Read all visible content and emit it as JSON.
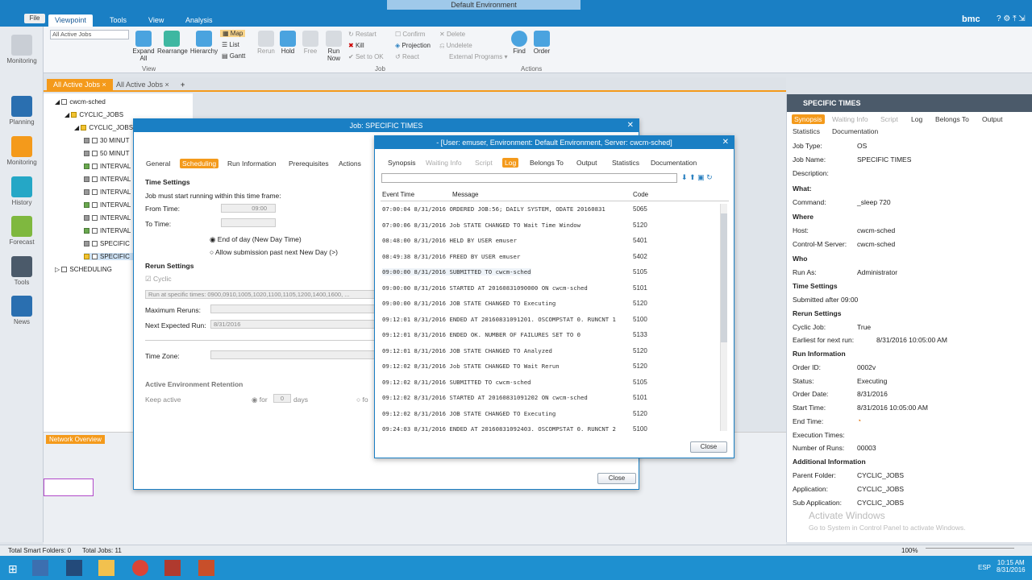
{
  "window": {
    "title": "Default Environment",
    "brand": "bmc"
  },
  "ribbon": {
    "file_label": "File",
    "tabs": [
      "Viewpoint",
      "Tools",
      "View",
      "Analysis"
    ],
    "viewpoint_select": "All Active Jobs",
    "buttons": {
      "expand_all": "Expand All",
      "rearrange": "Rearrange",
      "hierarchy": "Hierarchy",
      "map": "Map",
      "list": "List",
      "gantt": "Gantt",
      "rerun": "Rerun",
      "hold": "Hold",
      "free": "Free",
      "run_now": "Run Now",
      "restart": "Restart",
      "kill": "Kill",
      "set_to_ok": "Set to OK",
      "confirm": "Confirm",
      "projection": "Projection",
      "react": "React",
      "delete": "Delete",
      "undelete": "Undelete",
      "external_programs": "External Programs",
      "find": "Find",
      "order": "Order"
    },
    "groups": {
      "view": "View",
      "job": "Job",
      "actions": "Actions"
    }
  },
  "leftnav": [
    "Monitoring",
    "Planning",
    "Monitoring",
    "History",
    "Forecast",
    "Tools",
    "News"
  ],
  "viewtabs": [
    "All Active Jobs",
    "All Active Jobs"
  ],
  "tree": {
    "root": "cwcm-sched",
    "folder": "CYCLIC_JOBS",
    "subfolder": "CYCLIC_JOBS",
    "items": [
      "30 MINUT",
      "50 MINUT",
      "INTERVAL",
      "INTERVAL",
      "INTERVAL",
      "INTERVAL",
      "INTERVAL",
      "INTERVAL",
      "SPECIFIC"
    ],
    "scheduling": "SCHEDULING"
  },
  "network_overview": "Network Overview",
  "status": {
    "folders": "Total Smart Folders: 0",
    "jobs": "Total Jobs: 11",
    "zoom": "100%"
  },
  "job_dialog": {
    "title": "Job: SPECIFIC TIMES",
    "tabs": [
      "General",
      "Scheduling",
      "Run Information",
      "Prerequisites",
      "Actions"
    ],
    "time_settings": "Time Settings",
    "must_start": "Job must start running within this time frame:",
    "from_time": "From Time:",
    "from_value": "09:00",
    "to_time": "To Time:",
    "end_of_day": "End of day (New Day Time)",
    "allow_submission": "Allow submission past next New Day (>)",
    "rerun_settings": "Rerun Settings",
    "cyclic": "Cyclic",
    "run_at": "Run at specific times: 0900,0910,1005,1020,1100,1105,1200,1400,1600, ...",
    "max_reruns": "Maximum Reruns:",
    "next_expected": "Next Expected Run:",
    "next_value": "8/31/2016",
    "time_zone": "Time Zone:",
    "retention": "Active Environment Retention",
    "keep_active": "Keep active",
    "for": "for",
    "keep_value": "0",
    "days": "days",
    "for2": "fo",
    "close": "Close"
  },
  "log_dialog": {
    "title": "- [User: emuser, Environment: Default Environment, Server: cwcm-sched]",
    "tabs": [
      "Synopsis",
      "Waiting Info",
      "Script",
      "Log",
      "Belongs To",
      "Output",
      "Statistics",
      "Documentation"
    ],
    "columns": [
      "Event Time",
      "Message",
      "Code"
    ],
    "rows": [
      [
        "07:00:04 8/31/2016 ORDERED JOB:56; DAILY SYSTEM, ODATE 20160831",
        "5065"
      ],
      [
        "07:00:06 8/31/2016 Job STATE CHANGED TO Wait Time Window",
        "5120"
      ],
      [
        "08:48:00 8/31/2016 HELD BY USER emuser",
        "5401"
      ],
      [
        "08:49:38 8/31/2016 FREED BY USER emuser",
        "5402"
      ],
      [
        "09:00:00 8/31/2016 SUBMITTED TO cwcm-sched",
        "5105"
      ],
      [
        "09:00:00 8/31/2016 STARTED AT 20160831090000 ON cwcm-sched",
        "5101"
      ],
      [
        "09:00:00 8/31/2016 JOB STATE CHANGED TO Executing",
        "5120"
      ],
      [
        "09:12:01 8/31/2016 ENDED AT 20160831091201. OSCOMPSTAT 0. RUNCNT 1",
        "5100"
      ],
      [
        "09:12:01 8/31/2016 ENDED OK. NUMBER OF FAILURES SET TO 0",
        "5133"
      ],
      [
        "09:12:01 8/31/2016 JOB STATE CHANGED TO Analyzed",
        "5120"
      ],
      [
        "09:12:02 8/31/2016 Job STATE CHANGED TO Wait Rerun",
        "5120"
      ],
      [
        "09:12:02 8/31/2016 SUBMITTED TO cwcm-sched",
        "5105"
      ],
      [
        "09:12:02 8/31/2016 STARTED AT 20160831091202 ON cwcm-sched",
        "5101"
      ],
      [
        "09:12:02 8/31/2016 JOB STATE CHANGED TO Executing",
        "5120"
      ],
      [
        "09:24:03 8/31/2016 ENDED AT 20160831092403. OSCOMPSTAT 0. RUNCNT 2",
        "5100"
      ]
    ],
    "close": "Close"
  },
  "right_pane": {
    "title": "SPECIFIC TIMES",
    "tabs": [
      "Synopsis",
      "Waiting Info",
      "Script",
      "Log",
      "Belongs To",
      "Output",
      "Statistics",
      "Documentation"
    ],
    "job_type_l": "Job Type:",
    "job_type": "OS",
    "job_name_l": "Job Name:",
    "job_name": "SPECIFIC TIMES",
    "description_l": "Description:",
    "what": "What:",
    "command_l": "Command:",
    "command": "_sleep 720",
    "where": "Where",
    "host_l": "Host:",
    "host": "cwcm-sched",
    "server_l": "Control-M Server:",
    "server": "cwcm-sched",
    "who": "Who",
    "run_as_l": "Run As:",
    "run_as": "Administrator",
    "time_settings": "Time Settings",
    "submitted_after": "Submitted after 09:00",
    "rerun_settings": "Rerun Settings",
    "cyclic_l": "Cyclic Job:",
    "cyclic": "True",
    "earliest_l": "Earliest for next run:",
    "earliest": "8/31/2016 10:05:00 AM",
    "run_info": "Run Information",
    "order_id_l": "Order ID:",
    "order_id": "0002v",
    "status_l": "Status:",
    "status": "Executing",
    "order_date_l": "Order Date:",
    "order_date": "8/31/2016",
    "start_time_l": "Start Time:",
    "start_time": "8/31/2016 10:05:00 AM",
    "end_time_l": "End Time:",
    "exec_times_l": "Execution Times:",
    "num_runs_l": "Number of Runs:",
    "num_runs": "00003",
    "additional": "Additional Information",
    "parent_l": "Parent Folder:",
    "parent": "CYCLIC_JOBS",
    "app_l": "Application:",
    "app": "CYCLIC_JOBS",
    "subapp_l": "Sub Application:",
    "subapp": "CYCLIC_JOBS",
    "activate": "Activate Windows",
    "activate_sub": "Go to System in Control Panel to activate Windows."
  },
  "taskbar": {
    "time": "10:15 AM",
    "date": "8/31/2016",
    "lang": "ESP"
  }
}
